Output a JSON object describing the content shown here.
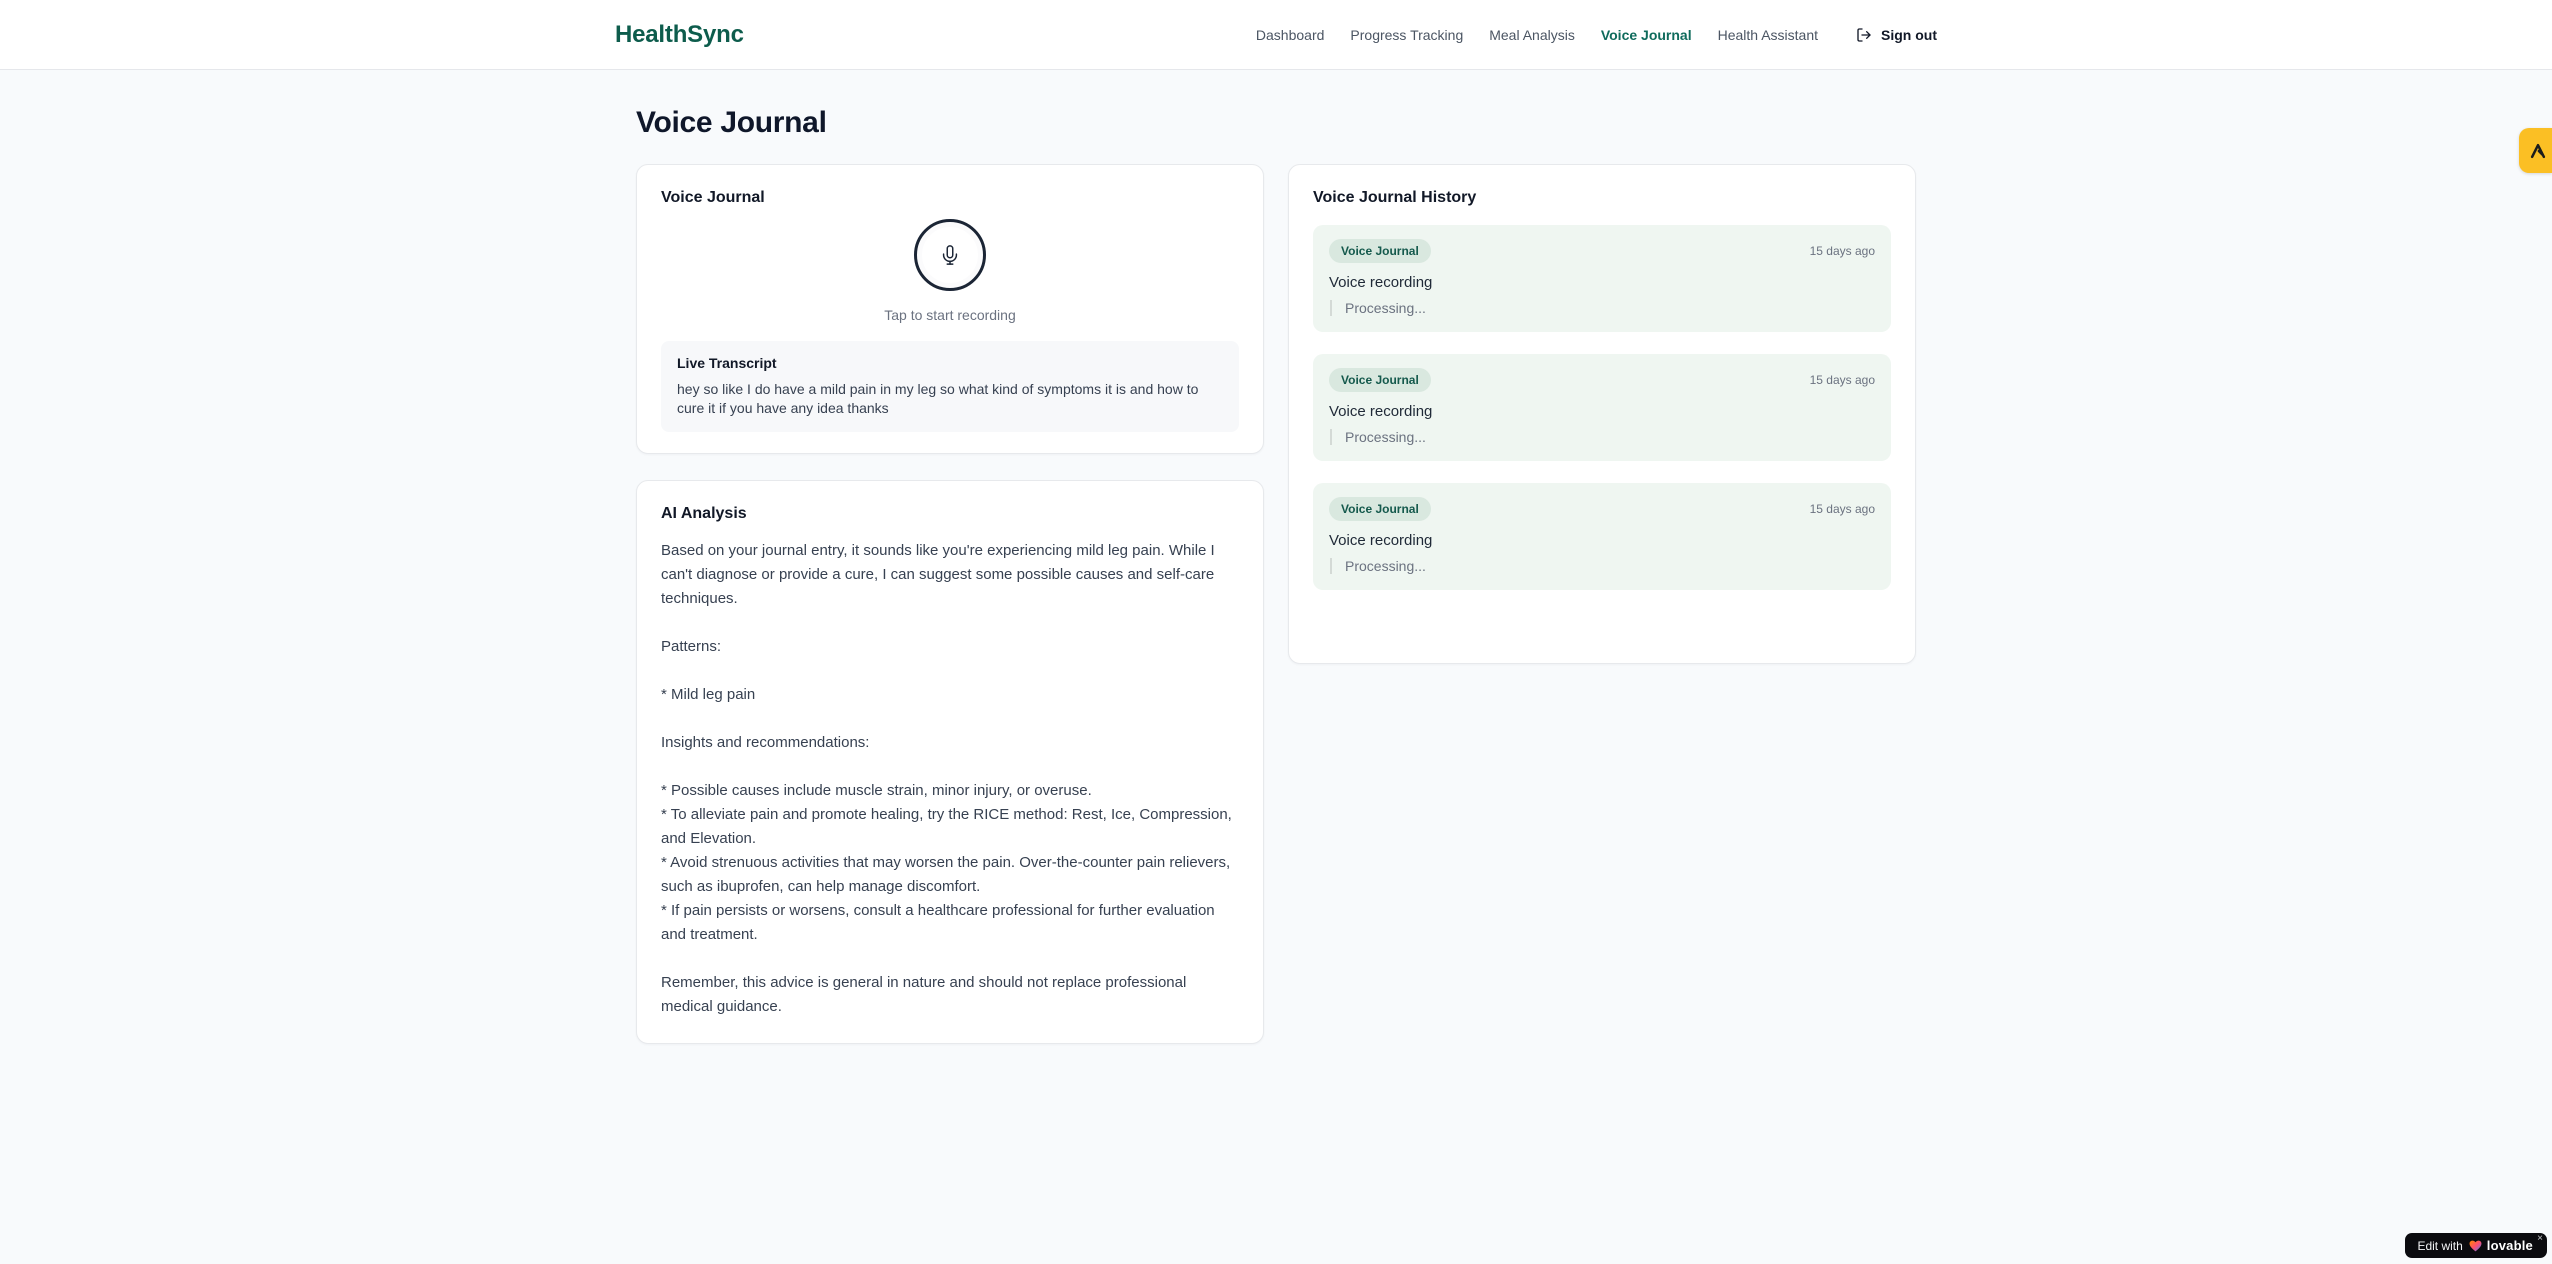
{
  "header": {
    "logo": "HealthSync",
    "nav": [
      {
        "label": "Dashboard",
        "active": false
      },
      {
        "label": "Progress Tracking",
        "active": false
      },
      {
        "label": "Meal Analysis",
        "active": false
      },
      {
        "label": "Voice Journal",
        "active": true
      },
      {
        "label": "Health Assistant",
        "active": false
      }
    ],
    "sign_out_label": "Sign out"
  },
  "page": {
    "title": "Voice Journal"
  },
  "recorder_card": {
    "title": "Voice Journal",
    "tap_hint": "Tap to start recording",
    "transcript_title": "Live Transcript",
    "transcript_text": "hey so like I do have a mild pain in my leg so what kind of symptoms it is and how to cure it if you have any idea thanks"
  },
  "analysis_card": {
    "title": "AI Analysis",
    "body": "Based on your journal entry, it sounds like you're experiencing mild leg pain. While I can't diagnose or provide a cure, I can suggest some possible causes and self-care techniques.\n\nPatterns:\n\n* Mild leg pain\n\nInsights and recommendations:\n\n* Possible causes include muscle strain, minor injury, or overuse.\n* To alleviate pain and promote healing, try the RICE method: Rest, Ice, Compression, and Elevation.\n* Avoid strenuous activities that may worsen the pain. Over-the-counter pain relievers, such as ibuprofen, can help manage discomfort.\n* If pain persists or worsens, consult a healthcare professional for further evaluation and treatment.\n\nRemember, this advice is general in nature and should not replace professional medical guidance."
  },
  "history_card": {
    "title": "Voice Journal History",
    "entries": [
      {
        "badge": "Voice Journal",
        "time": "15 days ago",
        "label": "Voice recording",
        "status": "Processing..."
      },
      {
        "badge": "Voice Journal",
        "time": "15 days ago",
        "label": "Voice recording",
        "status": "Processing..."
      },
      {
        "badge": "Voice Journal",
        "time": "15 days ago",
        "label": "Voice recording",
        "status": "Processing..."
      }
    ]
  },
  "lovable_badge": {
    "prefix": "Edit with",
    "brand": "lovable",
    "close": "×"
  },
  "colors": {
    "brand_green": "#0d5c4c",
    "nav_active": "#0f6b5c",
    "nav_inactive": "#4b5563",
    "page_bg": "#f8fafc",
    "entry_bg": "#eff6f1",
    "badge_bg": "#d9e8df",
    "badge_text": "#14594c",
    "side_tab_amber": "#fbbf24",
    "muted_text": "#6b7280"
  }
}
